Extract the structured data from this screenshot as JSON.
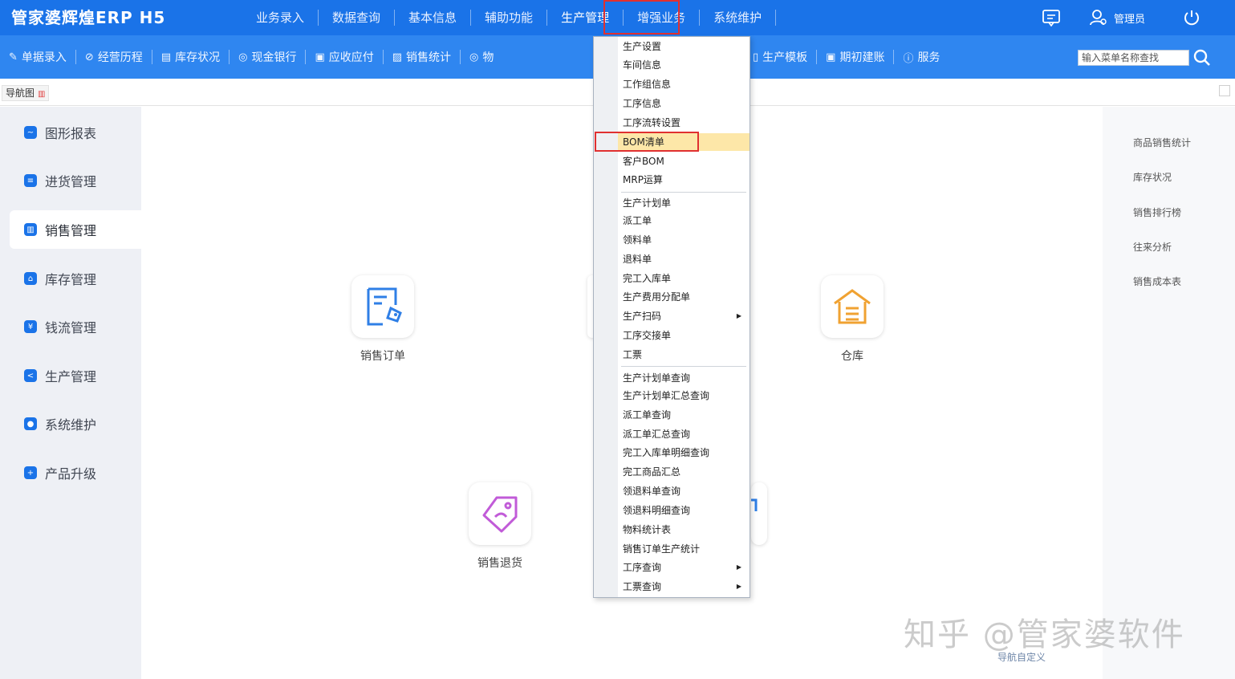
{
  "app": {
    "logo": "管家婆辉煌ERP H5",
    "user": "管理员"
  },
  "top_nav": [
    "业务录入",
    "数据查询",
    "基本信息",
    "辅助功能",
    "生产管理",
    "增强业务",
    "系统维护"
  ],
  "toolbar": {
    "left": [
      {
        "icon": "edit-icon",
        "label": "单据录入"
      },
      {
        "icon": "check-circle-icon",
        "label": "经营历程"
      },
      {
        "icon": "calendar-icon",
        "label": "库存状况"
      },
      {
        "icon": "coin-icon",
        "label": "现金银行"
      },
      {
        "icon": "ledger-icon",
        "label": "应收应付"
      },
      {
        "icon": "chart-icon",
        "label": "销售统计"
      },
      {
        "icon": "box-icon",
        "label": "物"
      }
    ],
    "right": [
      {
        "icon": "template-icon",
        "label": "生产模板"
      },
      {
        "icon": "setup-icon",
        "label": "期初建账"
      },
      {
        "icon": "help-icon",
        "label": "服务"
      }
    ],
    "search_placeholder": "输入菜单名称查找"
  },
  "tabs": [
    {
      "label": "导航图"
    }
  ],
  "sidebar": [
    {
      "icon": "chart-icon",
      "label": "图形报表"
    },
    {
      "icon": "purchase-icon",
      "label": "进货管理"
    },
    {
      "icon": "sales-icon",
      "label": "销售管理"
    },
    {
      "icon": "inventory-icon",
      "label": "库存管理"
    },
    {
      "icon": "money-icon",
      "label": "钱流管理"
    },
    {
      "icon": "production-icon",
      "label": "生产管理"
    },
    {
      "icon": "settings-icon",
      "label": "系统维护"
    },
    {
      "icon": "upgrade-icon",
      "label": "产品升级"
    }
  ],
  "sidebar_active": 2,
  "tiles": [
    {
      "icon": "sales-order-icon",
      "label": "销售订单",
      "color": "#2f7fe6"
    },
    {
      "icon": "warehouse-icon",
      "label": "仓库",
      "color": "#f0a232"
    },
    {
      "icon": "sales-return-icon",
      "label": "销售退货",
      "color": "#c15bd8"
    }
  ],
  "right_panel": [
    "商品销售统计",
    "库存状况",
    "销售排行榜",
    "往来分析",
    "销售成本表"
  ],
  "nav_custom": "导航自定义",
  "watermark": "知乎 @管家婆软件",
  "dropdown": {
    "groups": [
      [
        "生产设置",
        "车间信息",
        "工作组信息",
        "工序信息",
        "工序流转设置",
        "BOM清单",
        "客户BOM",
        "MRP运算"
      ],
      [
        "生产计划单",
        "派工单",
        "领料单",
        "退料单",
        "完工入库单",
        "生产费用分配单",
        "生产扫码",
        "工序交接单",
        "工票"
      ],
      [
        "生产计划单查询",
        "生产计划单汇总查询",
        "派工单查询",
        "派工单汇总查询",
        "完工入库单明细查询",
        "完工商品汇总",
        "领退料单查询",
        "领退料明细查询",
        "物料统计表",
        "销售订单生产统计",
        "工序查询",
        "工票查询"
      ]
    ],
    "selected": "BOM清单",
    "submenu_items": [
      "生产扫码",
      "工序查询",
      "工票查询"
    ]
  },
  "colors": {
    "header": "#1a73e8",
    "toolbar": "#2f86f0",
    "highlight": "#e03030",
    "selected_row": "#fde7a8"
  }
}
